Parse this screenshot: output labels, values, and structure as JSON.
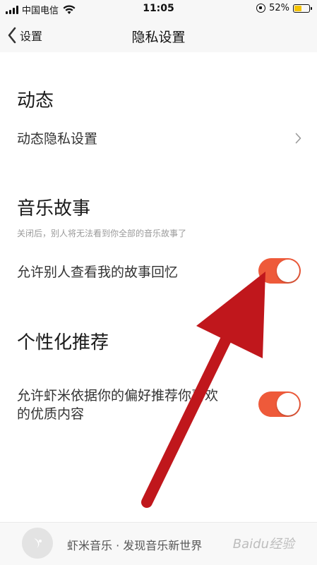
{
  "status_bar": {
    "carrier": "中国电信",
    "time": "11:05",
    "battery_percent": "52%",
    "battery_level": 0.52
  },
  "nav": {
    "back_label": "设置",
    "title": "隐私设置"
  },
  "sections": {
    "dynamic": {
      "title": "动态",
      "row_label": "动态隐私设置"
    },
    "music_story": {
      "title": "音乐故事",
      "hint": "关闭后，别人将无法看到你全部的音乐故事了",
      "row_label": "允许别人查看我的故事回忆",
      "toggle_on": true
    },
    "personalized": {
      "title": "个性化推荐",
      "row_label_line1": "允许虾米依据你的偏好推荐你喜欢",
      "row_label_line2": "的优质内容",
      "toggle_on": true
    }
  },
  "promo": {
    "text": "虾米音乐 · 发现音乐新世界"
  },
  "watermark": "Baidu经验",
  "colors": {
    "toggle_on": "#ee5a3a",
    "arrow": "#c0171c",
    "battery": "#f5c400"
  }
}
